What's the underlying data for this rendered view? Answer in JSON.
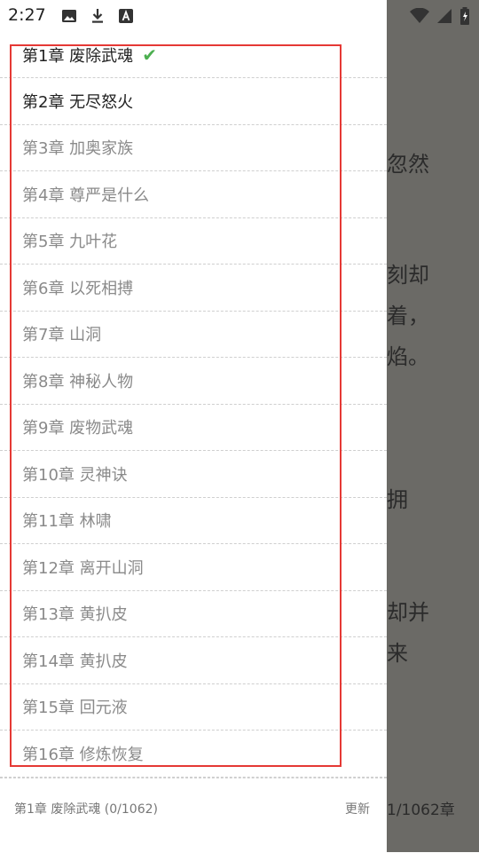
{
  "status_bar": {
    "time": "2:27"
  },
  "reader": {
    "lines": [
      "忽然",
      "刻却",
      "着，",
      "焰。",
      "拥",
      "却并",
      "来"
    ],
    "footer_progress": "1/1062章"
  },
  "drawer": {
    "chapters": [
      {
        "label": "第1章 废除武魂",
        "read": true,
        "current": true
      },
      {
        "label": "第2章 无尽怒火",
        "read": true
      },
      {
        "label": "第3章 加奥家族",
        "read": false
      },
      {
        "label": "第4章 尊严是什么",
        "read": false
      },
      {
        "label": "第5章 九叶花",
        "read": false
      },
      {
        "label": "第6章 以死相搏",
        "read": false
      },
      {
        "label": "第7章 山洞",
        "read": false
      },
      {
        "label": "第8章 神秘人物",
        "read": false
      },
      {
        "label": "第9章 废物武魂",
        "read": false
      },
      {
        "label": "第10章 灵神诀",
        "read": false
      },
      {
        "label": "第11章 林啸",
        "read": false
      },
      {
        "label": "第12章 离开山洞",
        "read": false
      },
      {
        "label": "第13章 黄扒皮",
        "read": false
      },
      {
        "label": "第14章 黄扒皮",
        "read": false
      },
      {
        "label": "第15章 回元液",
        "read": false
      },
      {
        "label": "第16章 修炼恢复",
        "read": false
      }
    ],
    "footer": {
      "current": "第1章 废除武魂 (0/1062)",
      "update_label": "更新"
    }
  },
  "colors": {
    "highlight": "#e53935",
    "check": "#4caf50",
    "read_text": "#222222",
    "unread_text": "#8a8a8a",
    "overlay": "#6b6a66"
  }
}
